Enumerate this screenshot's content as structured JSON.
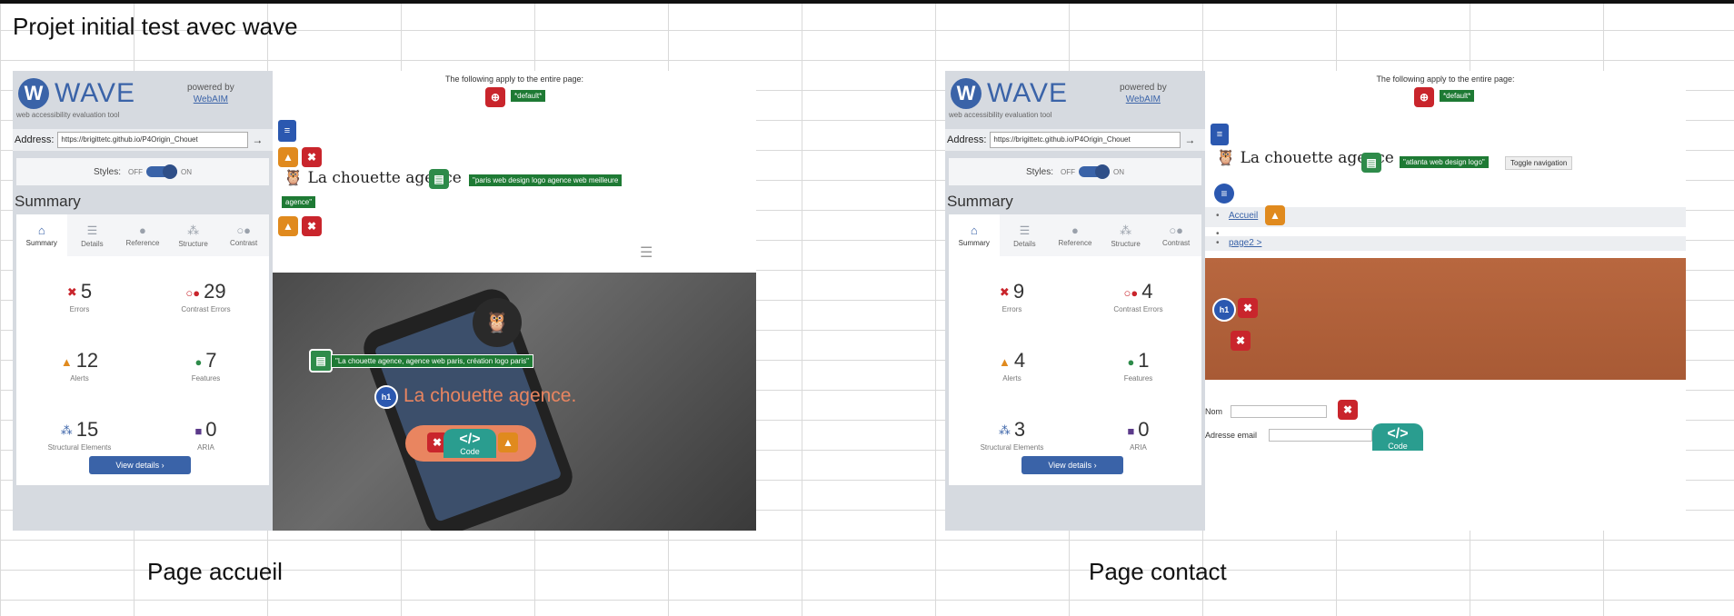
{
  "sheet": {
    "title": "Projet initial test avec wave",
    "caption_left": "Page accueil",
    "caption_right": "Page contact"
  },
  "colors": {
    "wave_blue": "#3a63a8",
    "error_red": "#c9252c",
    "alert_orange": "#e08a1e",
    "feature_green": "#1e7a34",
    "hero_text": "#e98560",
    "contact_band": "#b8673f"
  },
  "wave": {
    "name": "WAVE",
    "sub": "web accessibility evaluation tool",
    "powered_by": "powered by",
    "webaim": "WebAIM",
    "address_label": "Address:",
    "styles_label": "Styles:",
    "styles_off": "OFF",
    "styles_on": "ON",
    "summary_title": "Summary",
    "tabs": [
      {
        "label": "Summary",
        "icon": "home-icon"
      },
      {
        "label": "Details",
        "icon": "list-icon"
      },
      {
        "label": "Reference",
        "icon": "info-icon"
      },
      {
        "label": "Structure",
        "icon": "structure-icon"
      },
      {
        "label": "Contrast",
        "icon": "contrast-icon"
      }
    ],
    "stat_labels": {
      "errors": "Errors",
      "contrast": "Contrast Errors",
      "alerts": "Alerts",
      "features": "Features",
      "structural": "Structural Elements",
      "aria": "ARIA"
    },
    "view_details": "View details ›",
    "apply_text": "The following apply to the entire page:",
    "default_label": "*default*"
  },
  "left": {
    "address": "https://brigittetc.github.io/P4Origin_Chouet",
    "stats": {
      "errors": "5",
      "contrast": "29",
      "alerts": "12",
      "features": "7",
      "structural": "15",
      "aria": "0"
    },
    "logo_text": "La chouette agence",
    "alt_text_1": "\"paris web design logo agence web meilleure",
    "alt_text_2": "agence\"",
    "hero_alt": "\"La chouette agence, agence web paris, création logo paris\"",
    "hero_title": "La chouette agence.",
    "h1_badge": "h1",
    "code_label": "Code"
  },
  "right": {
    "address": "https://brigittetc.github.io/P4Origin_Chouet",
    "stats": {
      "errors": "9",
      "contrast": "4",
      "alerts": "4",
      "features": "1",
      "structural": "3",
      "aria": "0"
    },
    "logo_text": "La chouette agence",
    "alt_text": "\"atlanta web design logo\"",
    "toggle_nav": "Toggle navigation",
    "nav_accueil": "Accueil",
    "nav_page2": "page2 >",
    "h1_badge": "h1",
    "form_nom": "Nom",
    "form_email": "Adresse email",
    "code_label": "Code"
  }
}
